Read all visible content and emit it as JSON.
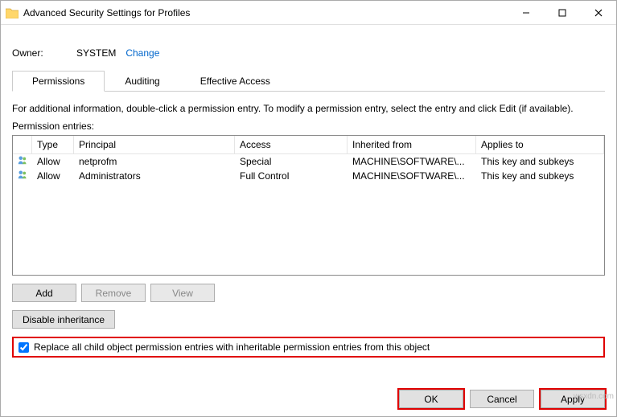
{
  "window": {
    "title": "Advanced Security Settings for Profiles"
  },
  "owner": {
    "label": "Owner:",
    "value": "SYSTEM",
    "change": "Change"
  },
  "tabs": {
    "permissions": "Permissions",
    "auditing": "Auditing",
    "effective": "Effective Access"
  },
  "instructions": "For additional information, double-click a permission entry. To modify a permission entry, select the entry and click Edit (if available).",
  "entries_label": "Permission entries:",
  "columns": {
    "type": "Type",
    "principal": "Principal",
    "access": "Access",
    "inherited": "Inherited from",
    "applies": "Applies to"
  },
  "rows": [
    {
      "type": "Allow",
      "principal": "netprofm",
      "access": "Special",
      "inherited": "MACHINE\\SOFTWARE\\...",
      "applies": "This key and subkeys"
    },
    {
      "type": "Allow",
      "principal": "Administrators",
      "access": "Full Control",
      "inherited": "MACHINE\\SOFTWARE\\...",
      "applies": "This key and subkeys"
    }
  ],
  "buttons": {
    "add": "Add",
    "remove": "Remove",
    "view": "View",
    "disable_inheritance": "Disable inheritance",
    "ok": "OK",
    "cancel": "Cancel",
    "apply": "Apply"
  },
  "checkbox": {
    "label": "Replace all child object permission entries with inheritable permission entries from this object",
    "checked": true
  },
  "watermark": "wsxdn.com"
}
